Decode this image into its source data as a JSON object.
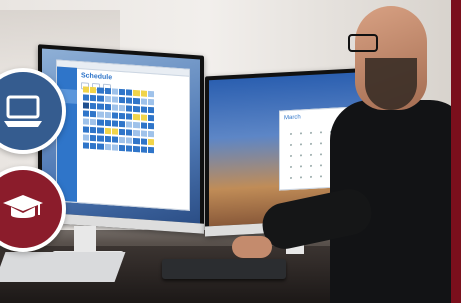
{
  "left_app": {
    "title": "Schedule",
    "sidebar": [
      "",
      "",
      "",
      "",
      ""
    ],
    "toolbar": [
      "",
      "",
      ""
    ]
  },
  "right_app": {
    "title": "March"
  },
  "badges": [
    {
      "name": "laptop-badge",
      "icon": "laptop-icon"
    },
    {
      "name": "graduation-cap-badge",
      "icon": "graduation-cap-icon"
    }
  ],
  "colors": {
    "brand_red": "#8b1c2b",
    "brand_blue": "#355c8f",
    "accent_yellow": "#f1d44a",
    "accent_blue": "#2f75c9"
  }
}
